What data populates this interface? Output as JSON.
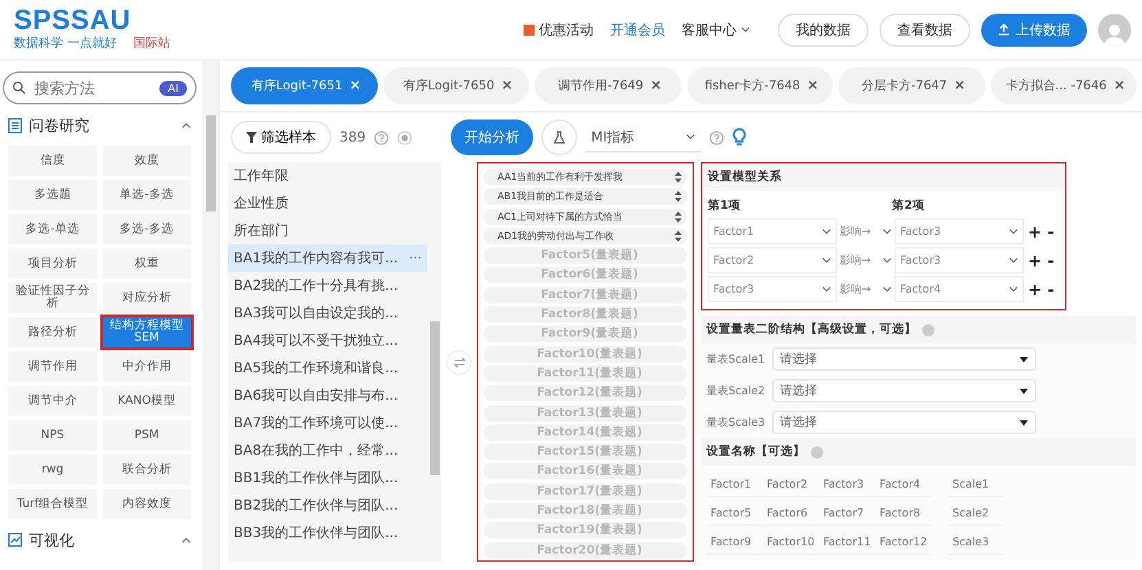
{
  "header": {
    "logo": "SPSSAU",
    "slogan": "数据科学 一点就好",
    "site": "国际站",
    "nav": [
      {
        "label": "优惠活动",
        "kind": "promo"
      },
      {
        "label": "开通会员",
        "kind": "link"
      },
      {
        "label": "客服中心",
        "kind": "dropdown"
      }
    ],
    "buttons": [
      {
        "label": "我的数据",
        "kind": "outline"
      },
      {
        "label": "查看数据",
        "kind": "outline"
      },
      {
        "label": "上传数据",
        "kind": "primary"
      }
    ]
  },
  "tabs": [
    {
      "label": "有序Logit-7651",
      "selected": true,
      "close": "×"
    },
    {
      "label": "有序Logit-7650",
      "selected": false,
      "close": "×"
    },
    {
      "label": "调节作用-7649",
      "selected": false,
      "close": "×"
    },
    {
      "label": "fisher卡方-7648",
      "selected": false,
      "close": "×"
    },
    {
      "label": "分层卡方-7647",
      "selected": false,
      "close": "×"
    },
    {
      "label": "卡方拟合... -7646",
      "selected": false,
      "close": "×"
    }
  ],
  "sidebar": {
    "search": {
      "placeholder": "搜索方法",
      "badge": "AI"
    },
    "sections": [
      {
        "title": "问卷研究",
        "expanded": true,
        "methods": [
          {
            "label": "信度",
            "selected": false
          },
          {
            "label": "效度",
            "selected": false
          },
          {
            "label": "多选题",
            "selected": false
          },
          {
            "label": "单选-多选",
            "selected": false
          },
          {
            "label": "多选-单选",
            "selected": false
          },
          {
            "label": "多选-多选",
            "selected": false
          },
          {
            "label": "项目分析",
            "selected": false
          },
          {
            "label": "权重",
            "selected": false
          },
          {
            "label": "验证性因子分析",
            "selected": false
          },
          {
            "label": "对应分析",
            "selected": false
          },
          {
            "label": "路径分析",
            "selected": false
          },
          {
            "label": "结构方程模型SEM",
            "selected": true,
            "highlighted": true
          },
          {
            "label": "调节作用",
            "selected": false
          },
          {
            "label": "中介作用",
            "selected": false
          },
          {
            "label": "调节中介",
            "selected": false
          },
          {
            "label": "KANO模型",
            "selected": false
          },
          {
            "label": "NPS",
            "selected": false
          },
          {
            "label": "PSM",
            "selected": false
          },
          {
            "label": "rwg",
            "selected": false
          },
          {
            "label": "联合分析",
            "selected": false
          },
          {
            "label": "Turf组合模型",
            "selected": false
          },
          {
            "label": "内容效度",
            "selected": false
          }
        ]
      },
      {
        "title": "可视化",
        "expanded": true
      }
    ]
  },
  "toolbar": {
    "filter": "筛选样本",
    "count": "389",
    "start": "开始分析",
    "index": "MI指标"
  },
  "variables": [
    {
      "label": "工作年限",
      "selected": false
    },
    {
      "label": "企业性质",
      "selected": false
    },
    {
      "label": "所在部门",
      "selected": false
    },
    {
      "label": "BA1我的工作内容有我可...",
      "selected": true,
      "more": "···"
    },
    {
      "label": "BA2我的工作十分具有挑...",
      "selected": false
    },
    {
      "label": "BA3我可以自由设定我的...",
      "selected": false
    },
    {
      "label": "BA4我可以不受干扰独立...",
      "selected": false
    },
    {
      "label": "BA5我的工作环境和谐良...",
      "selected": false
    },
    {
      "label": "BA6我可以自由安排与布...",
      "selected": false
    },
    {
      "label": "BA7我的工作环境可以使...",
      "selected": false
    },
    {
      "label": "BA8在我的工作中，经常...",
      "selected": false
    },
    {
      "label": "BB1我的工作伙伴与团队...",
      "selected": false
    },
    {
      "label": "BB2我的工作伙伴与团队...",
      "selected": false
    },
    {
      "label": "BB3我的工作伙伴与团队...",
      "selected": false
    }
  ],
  "factor_slots": {
    "highlighted": true,
    "items": [
      {
        "label": "AA1当前的工作有利于发挥我",
        "kind": "filled"
      },
      {
        "label": "AB1我目前的工作是适合",
        "kind": "filled"
      },
      {
        "label": "AC1上司对待下属的方式恰当",
        "kind": "filled"
      },
      {
        "label": "AD1我的劳动付出与工作收",
        "kind": "filled"
      },
      {
        "label": "Factor5(量表题)",
        "kind": "empty"
      },
      {
        "label": "Factor6(量表题)",
        "kind": "empty"
      },
      {
        "label": "Factor7(量表题)",
        "kind": "empty"
      },
      {
        "label": "Factor8(量表题)",
        "kind": "empty"
      },
      {
        "label": "Factor9(量表题)",
        "kind": "empty"
      },
      {
        "label": "Factor10(量表题)",
        "kind": "empty"
      },
      {
        "label": "Factor11(量表题)",
        "kind": "empty"
      },
      {
        "label": "Factor12(量表题)",
        "kind": "empty"
      },
      {
        "label": "Factor13(量表题)",
        "kind": "empty"
      },
      {
        "label": "Factor14(量表题)",
        "kind": "empty"
      },
      {
        "label": "Factor15(量表题)",
        "kind": "empty"
      },
      {
        "label": "Factor16(量表题)",
        "kind": "empty"
      },
      {
        "label": "Factor17(量表题)",
        "kind": "empty"
      },
      {
        "label": "Factor18(量表题)",
        "kind": "empty"
      },
      {
        "label": "Factor19(量表题)",
        "kind": "empty"
      },
      {
        "label": "Factor20(量表题)",
        "kind": "empty"
      }
    ]
  },
  "model_relation": {
    "title": "设置模型关系",
    "highlighted": true,
    "col1": "第1项",
    "col2": "第2项",
    "rows": [
      {
        "from": "Factor1",
        "relation": "影响→",
        "to": "Factor3",
        "add": "+",
        "remove": "-"
      },
      {
        "from": "Factor2",
        "relation": "影响→",
        "to": "Factor3",
        "add": "+",
        "remove": "-"
      },
      {
        "from": "Factor3",
        "relation": "影响→",
        "to": "Factor4",
        "add": "+",
        "remove": "-"
      }
    ]
  },
  "second_order": {
    "title": "设置量表二阶结构【高级设置，可选】",
    "rows": [
      {
        "label": "量表Scale1",
        "placeholder": "请选择"
      },
      {
        "label": "量表Scale2",
        "placeholder": "请选择"
      },
      {
        "label": "量表Scale3",
        "placeholder": "请选择"
      }
    ]
  },
  "names": {
    "title": "设置名称【可选】",
    "rows": [
      [
        "Factor1",
        "Factor2",
        "Factor3",
        "Factor4",
        "Scale1"
      ],
      [
        "Factor5",
        "Factor6",
        "Factor7",
        "Factor8",
        "Scale2"
      ],
      [
        "Factor9",
        "Factor10",
        "Factor11",
        "Factor12",
        "Scale3"
      ]
    ]
  }
}
